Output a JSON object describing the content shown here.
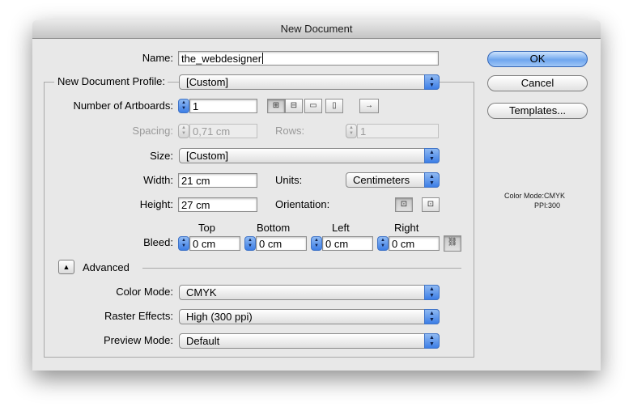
{
  "window": {
    "title": "New Document"
  },
  "name": {
    "label": "Name:",
    "value": "the_webdesigner"
  },
  "profile": {
    "label": "New Document Profile:",
    "value": "[Custom]"
  },
  "artboards": {
    "label": "Number of Artboards:",
    "value": "1",
    "layout_icons": [
      "grid-by-row-icon",
      "grid-by-column-icon",
      "arrange-by-row-icon",
      "arrange-by-column-icon"
    ],
    "direction_icon": "right-arrow-icon"
  },
  "spacing": {
    "label": "Spacing:",
    "value": "0,71 cm"
  },
  "rows": {
    "label": "Rows:",
    "value": "1"
  },
  "size": {
    "label": "Size:",
    "value": "[Custom]"
  },
  "width": {
    "label": "Width:",
    "value": "21 cm"
  },
  "units": {
    "label": "Units:",
    "value": "Centimeters"
  },
  "height": {
    "label": "Height:",
    "value": "27 cm"
  },
  "orientation": {
    "label": "Orientation:",
    "portrait_icon": "portrait-icon",
    "landscape_icon": "landscape-icon"
  },
  "bleed": {
    "label": "Bleed:",
    "top_label": "Top",
    "bottom_label": "Bottom",
    "left_label": "Left",
    "right_label": "Right",
    "top": "0 cm",
    "bottom": "0 cm",
    "left": "0 cm",
    "right": "0 cm",
    "link_icon": "chain-link-icon"
  },
  "advanced": {
    "label": "Advanced",
    "color_mode_label": "Color Mode:",
    "color_mode": "CMYK",
    "raster_label": "Raster Effects:",
    "raster": "High (300 ppi)",
    "preview_label": "Preview Mode:",
    "preview": "Default"
  },
  "buttons": {
    "ok": "OK",
    "cancel": "Cancel",
    "templates": "Templates..."
  },
  "info": {
    "color_mode": "Color Mode:CMYK",
    "ppi": "PPI:300"
  }
}
